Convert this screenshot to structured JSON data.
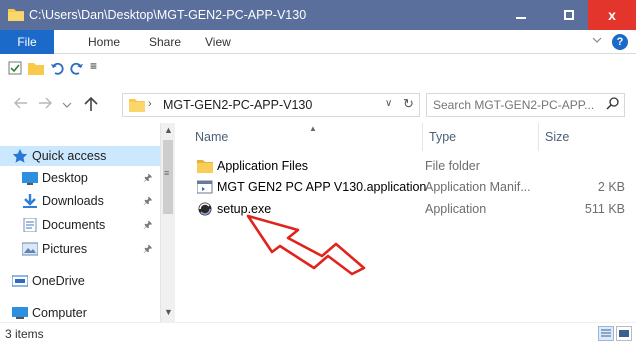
{
  "window": {
    "title": "C:\\Users\\Dan\\Desktop\\MGT-GEN2-PC-APP-V130",
    "minimize": "—",
    "maximize": "☐",
    "close": "x"
  },
  "ribbon": {
    "tabs": [
      "File",
      "Home",
      "Share",
      "View"
    ],
    "expand_icon": "chevron-down-icon",
    "help": "?"
  },
  "quick_access": {
    "customize": "≡"
  },
  "address": {
    "crumb_separator": "›",
    "path": "MGT-GEN2-PC-APP-V130",
    "dropdown": "∨",
    "refresh": "↻"
  },
  "search": {
    "placeholder": "Search MGT-GEN2-PC-APP..."
  },
  "nav_pane": {
    "items": [
      {
        "label": "Quick access",
        "icon": "star-icon",
        "pinned": false
      },
      {
        "label": "Desktop",
        "icon": "desktop-icon",
        "pinned": true
      },
      {
        "label": "Downloads",
        "icon": "download-icon",
        "pinned": true
      },
      {
        "label": "Documents",
        "icon": "documents-icon",
        "pinned": true
      },
      {
        "label": "Pictures",
        "icon": "pictures-icon",
        "pinned": true
      },
      {
        "label": "OneDrive",
        "icon": "onedrive-icon",
        "pinned": false
      },
      {
        "label": "Computer",
        "icon": "computer-icon",
        "pinned": false
      }
    ]
  },
  "file_list": {
    "columns": {
      "name": "Name",
      "type": "Type",
      "size": "Size"
    },
    "rows": [
      {
        "name": "Application Files",
        "type": "File folder",
        "size": "",
        "icon": "folder-icon"
      },
      {
        "name": "MGT GEN2 PC APP V130.application",
        "type": "Application Manif...",
        "size": "2 KB",
        "icon": "application-manifest-icon"
      },
      {
        "name": "setup.exe",
        "type": "Application",
        "size": "511 KB",
        "icon": "setup-exe-icon"
      }
    ]
  },
  "status": {
    "item_count": "3 items"
  },
  "colors": {
    "titlebar": "#5a6f9c",
    "file_tab": "#1b6ac9",
    "close": "#e3352b",
    "selection": "#cce8ff",
    "annotation": "#e0241c"
  }
}
